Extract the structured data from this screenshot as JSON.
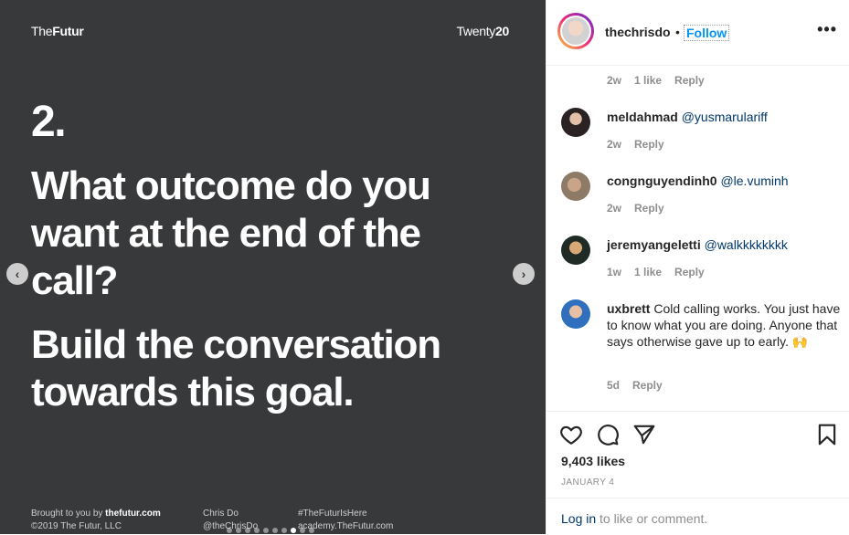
{
  "slide": {
    "brand_prefix": "The",
    "brand_bold": "Futur",
    "tag_prefix": "Twenty",
    "tag_bold": "20",
    "number": "2.",
    "question": "What outcome do you want at the end of the call?",
    "answer": "Build the conversation towards this goal.",
    "footer": {
      "col1_prefix": "Brought to you by ",
      "col1_bold": "thefutur.com",
      "col1_line2": "©2019 The Futur, LLC",
      "col2_line1": "Chris Do",
      "col2_line2": "@theChrisDo",
      "col3_line1": "#TheFuturIsHere",
      "col3_line2": "academy.TheFutur.com"
    },
    "prev_icon": "chevron-left-icon",
    "next_icon": "chevron-right-icon",
    "dots_total": 10,
    "dots_active_index": 7
  },
  "header": {
    "username": "thechrisdo",
    "separator": "•",
    "follow_label": "Follow",
    "more_icon": "more-horizontal-icon"
  },
  "comments": [
    {
      "time": "2w",
      "likes": "1 like",
      "reply": "Reply"
    },
    {
      "user": "meldahmad",
      "mention": "@yusmarulariff",
      "text": "",
      "time": "2w",
      "likes": "",
      "reply": "Reply"
    },
    {
      "user": "congnguyendinh0",
      "mention": "@le.vuminh",
      "text": "",
      "time": "2w",
      "likes": "",
      "reply": "Reply"
    },
    {
      "user": "jeremyangeletti",
      "mention": "@walkkkkkkkk",
      "text": "",
      "time": "1w",
      "likes": "1 like",
      "reply": "Reply"
    },
    {
      "user": "uxbrett",
      "mention": "",
      "text": "Cold calling works. You just have to know what you are doing. Anyone that says otherwise gave up to early. 🙌",
      "time": "5d",
      "likes": "",
      "reply": "Reply"
    }
  ],
  "actions": {
    "likes_text": "9,403 likes",
    "date": "JANUARY 4"
  },
  "login": {
    "link": "Log in",
    "rest": " to like or comment."
  }
}
